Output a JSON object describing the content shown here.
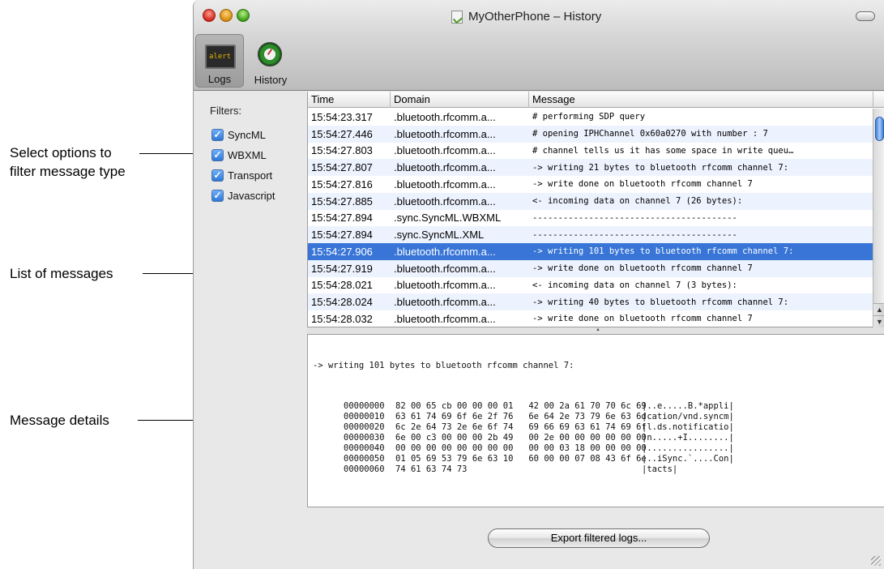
{
  "window": {
    "title": "MyOtherPhone – History"
  },
  "toolbar": {
    "logs_label": "Logs",
    "logs_icon_text": "alert",
    "history_label": "History"
  },
  "callouts": {
    "filters_line1": "Select options to",
    "filters_line2": "filter message type",
    "list": "List of messages",
    "details": "Message details"
  },
  "sidebar": {
    "title": "Filters:",
    "filters": [
      {
        "label": "SyncML",
        "checked": true
      },
      {
        "label": "WBXML",
        "checked": true
      },
      {
        "label": "Transport",
        "checked": true
      },
      {
        "label": "Javascript",
        "checked": true
      }
    ]
  },
  "table": {
    "columns": [
      "Time",
      "Domain",
      "Message"
    ],
    "rows": [
      {
        "time": "15:54:23.317",
        "domain": ".bluetooth.rfcomm.a...",
        "message": "# performing SDP query"
      },
      {
        "time": "15:54:27.446",
        "domain": ".bluetooth.rfcomm.a...",
        "message": "# opening IPHChannel 0x60a0270 with number : 7"
      },
      {
        "time": "15:54:27.803",
        "domain": ".bluetooth.rfcomm.a...",
        "message": "# channel tells us it has some space in write queu…"
      },
      {
        "time": "15:54:27.807",
        "domain": ".bluetooth.rfcomm.a...",
        "message": "-> writing 21 bytes to bluetooth rfcomm channel 7:"
      },
      {
        "time": "15:54:27.816",
        "domain": ".bluetooth.rfcomm.a...",
        "message": "-> write done on bluetooth rfcomm channel 7"
      },
      {
        "time": "15:54:27.885",
        "domain": ".bluetooth.rfcomm.a...",
        "message": "<- incoming data on channel 7 (26 bytes):"
      },
      {
        "time": "15:54:27.894",
        "domain": ".sync.SyncML.WBXML",
        "message": "----------------------------------------"
      },
      {
        "time": "15:54:27.894",
        "domain": ".sync.SyncML.XML",
        "message": "----------------------------------------"
      },
      {
        "time": "15:54:27.906",
        "domain": ".bluetooth.rfcomm.a...",
        "message": "-> writing 101 bytes to bluetooth rfcomm channel 7:"
      },
      {
        "time": "15:54:27.919",
        "domain": ".bluetooth.rfcomm.a...",
        "message": "-> write done on bluetooth rfcomm channel 7"
      },
      {
        "time": "15:54:28.021",
        "domain": ".bluetooth.rfcomm.a...",
        "message": "<- incoming data on channel 7 (3 bytes):"
      },
      {
        "time": "15:54:28.024",
        "domain": ".bluetooth.rfcomm.a...",
        "message": "-> writing 40 bytes to bluetooth rfcomm channel 7:"
      },
      {
        "time": "15:54:28.032",
        "domain": ".bluetooth.rfcomm.a...",
        "message": "-> write done on bluetooth rfcomm channel 7"
      }
    ],
    "selected_index": 8
  },
  "details": {
    "header": "-> writing 101 bytes to bluetooth rfcomm channel 7:",
    "hex": [
      {
        "offset": "00000000",
        "bytes": "82 00 65 cb 00 00 00 01   42 00 2a 61 70 70 6c 69",
        "ascii": "|..e.....B.*appli|"
      },
      {
        "offset": "00000010",
        "bytes": "63 61 74 69 6f 6e 2f 76   6e 64 2e 73 79 6e 63 6d",
        "ascii": "|cation/vnd.syncm|"
      },
      {
        "offset": "00000020",
        "bytes": "6c 2e 64 73 2e 6e 6f 74   69 66 69 63 61 74 69 6f",
        "ascii": "|l.ds.notificatio|"
      },
      {
        "offset": "00000030",
        "bytes": "6e 00 c3 00 00 00 2b 49   00 2e 00 00 00 00 00 00",
        "ascii": "|n.....+I........|"
      },
      {
        "offset": "00000040",
        "bytes": "00 00 00 00 00 00 00 00   00 00 03 18 00 00 00 00",
        "ascii": "|................|"
      },
      {
        "offset": "00000050",
        "bytes": "01 05 69 53 79 6e 63 10   60 00 00 07 08 43 6f 6e",
        "ascii": "|..iSync.`....Con|"
      },
      {
        "offset": "00000060",
        "bytes": "74 61 63 74 73",
        "ascii": "|tacts|"
      }
    ]
  },
  "export_button": {
    "label": "Export filtered logs..."
  },
  "colors": {
    "selection": "#3875d7",
    "row_alt": "#edf3fe",
    "checkbox": "#2e78d6"
  },
  "icons": [
    "close-icon",
    "minimize-icon",
    "zoom-icon",
    "document-icon",
    "toolbar-toggle-icon",
    "logs-icon",
    "history-icon"
  ]
}
